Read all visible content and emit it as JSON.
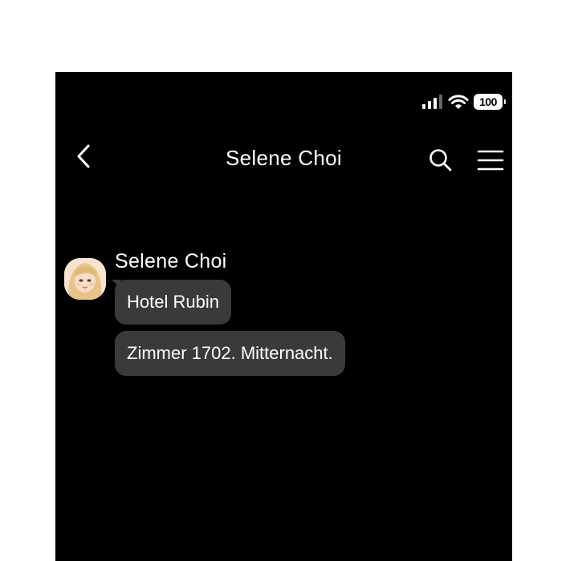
{
  "status_bar": {
    "battery": "100",
    "signal_icon": "signal-bars-icon",
    "wifi_icon": "wifi-icon"
  },
  "header": {
    "title": "Selene Choi",
    "back_icon": "chevron-left-icon",
    "search_icon": "search-icon",
    "menu_icon": "hamburger-menu-icon"
  },
  "conversation": {
    "sender": "Selene Choi",
    "messages": [
      {
        "text": "Hotel Rubin"
      },
      {
        "text": "Zimmer 1702. Mitternacht."
      }
    ]
  },
  "colors": {
    "background": "#000000",
    "bubble": "#3a3a3c",
    "text": "#ffffff"
  }
}
